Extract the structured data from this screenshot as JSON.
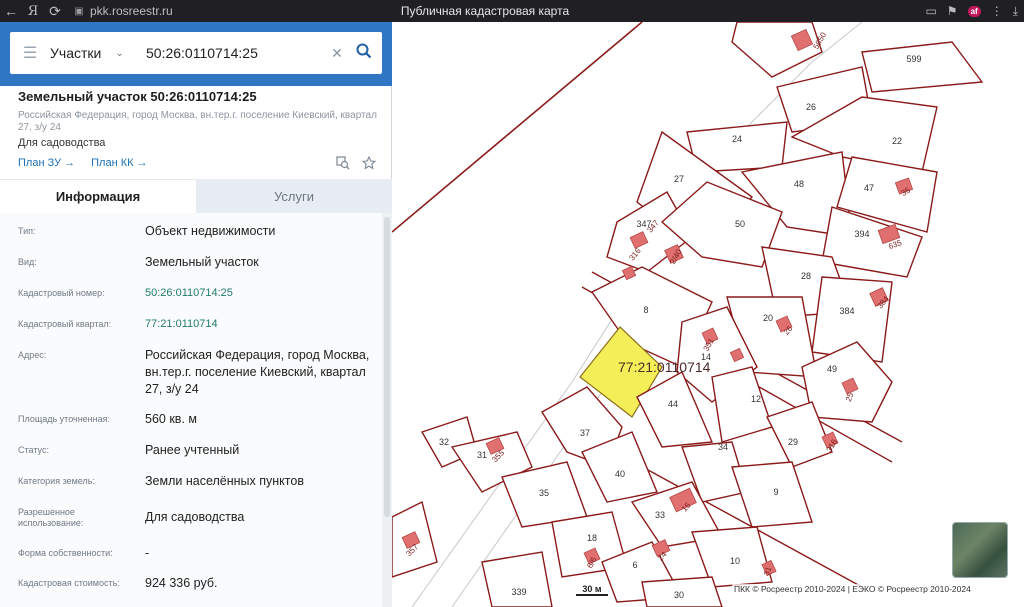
{
  "browser": {
    "url": "pkk.rosreestr.ru",
    "page_title": "Публичная кадастровая карта",
    "yandex_label": "Я",
    "ext_badge": "af"
  },
  "search": {
    "type_label": "Участки",
    "query": "50:26:0110714:25"
  },
  "parcel": {
    "title": "Земельный участок 50:26:0110714:25",
    "subtitle": "Российская Федерация, город Москва, вн.тер.г. поселение Киевский, квартал 27, з/у 24",
    "use": "Для садоводства",
    "plan_zu": "План ЗУ →",
    "plan_kk": "План КК →"
  },
  "tabs": {
    "info": "Информация",
    "services": "Услуги"
  },
  "info_rows": [
    {
      "label": "Тип:",
      "value": "Объект недвижимости"
    },
    {
      "label": "Вид:",
      "value": "Земельный участок"
    },
    {
      "label": "Кадастровый номер:",
      "value": "50:26:0110714:25"
    },
    {
      "label": "Кадастровый квартал:",
      "value": "77:21:0110714"
    },
    {
      "label": "Адрес:",
      "value": "Российская Федерация, город Москва, вн.тер.г. поселение Киевский, квартал 27, з/у 24"
    },
    {
      "label": "Площадь уточненная:",
      "value": "560 кв. м"
    },
    {
      "label": "Статус:",
      "value": "Ранее учтенный"
    },
    {
      "label": "Категория земель:",
      "value": "Земли населённых пунктов"
    },
    {
      "label": "Разрешенное использование:",
      "value": "Для садоводства"
    },
    {
      "label": "Форма собственности:",
      "value": "-"
    },
    {
      "label": "Кадастровая стоимость:",
      "value": "924 336 руб."
    }
  ],
  "map": {
    "quarter_label": "77:21:0110714",
    "scale": "30 м",
    "copyright": "ПКК © Росреестр 2010-2024 | ЕЭКО © Росреестр 2010-2024",
    "parcel_labels": [
      "599",
      "26",
      "24",
      "22",
      "27",
      "48",
      "47",
      "394",
      "347",
      "50",
      "28",
      "8",
      "384",
      "20",
      "14",
      "49",
      "44",
      "12",
      "37",
      "32",
      "34",
      "29",
      "31",
      "40",
      "35",
      "9",
      "33",
      "18",
      "6",
      "10",
      "339",
      "30"
    ],
    "building_labels": [
      "5050",
      "35",
      "635",
      "347",
      "2/40",
      "316",
      "384",
      "26",
      "351",
      "25",
      "316",
      "355",
      "15",
      "357",
      "6/6",
      "24",
      "31",
      "25"
    ]
  }
}
